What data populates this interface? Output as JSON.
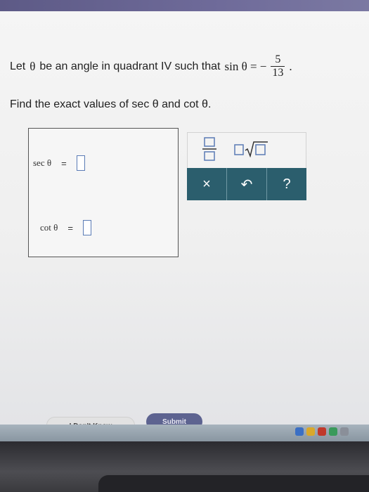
{
  "problem": {
    "prefix": "Let",
    "theta": "θ",
    "mid": "be an angle in quadrant IV such that",
    "sin_expr": "sin θ = −",
    "numerator": "5",
    "denominator": "13",
    "period": ".",
    "line2": "Find the exact values of sec θ and cot θ."
  },
  "answers": {
    "sec_label": "sec θ",
    "cot_label": "cot θ",
    "equals": "="
  },
  "toolpad": {
    "clear_symbol": "×",
    "undo_symbol": "↶",
    "help_symbol": "?"
  },
  "buttons": {
    "dont_know": "I Don't Know",
    "submit": "Submit"
  },
  "colors": {
    "toolbar_dark": "#2b5e6d",
    "submit_bg": "#5d6390",
    "input_border": "#5a7bb5"
  }
}
